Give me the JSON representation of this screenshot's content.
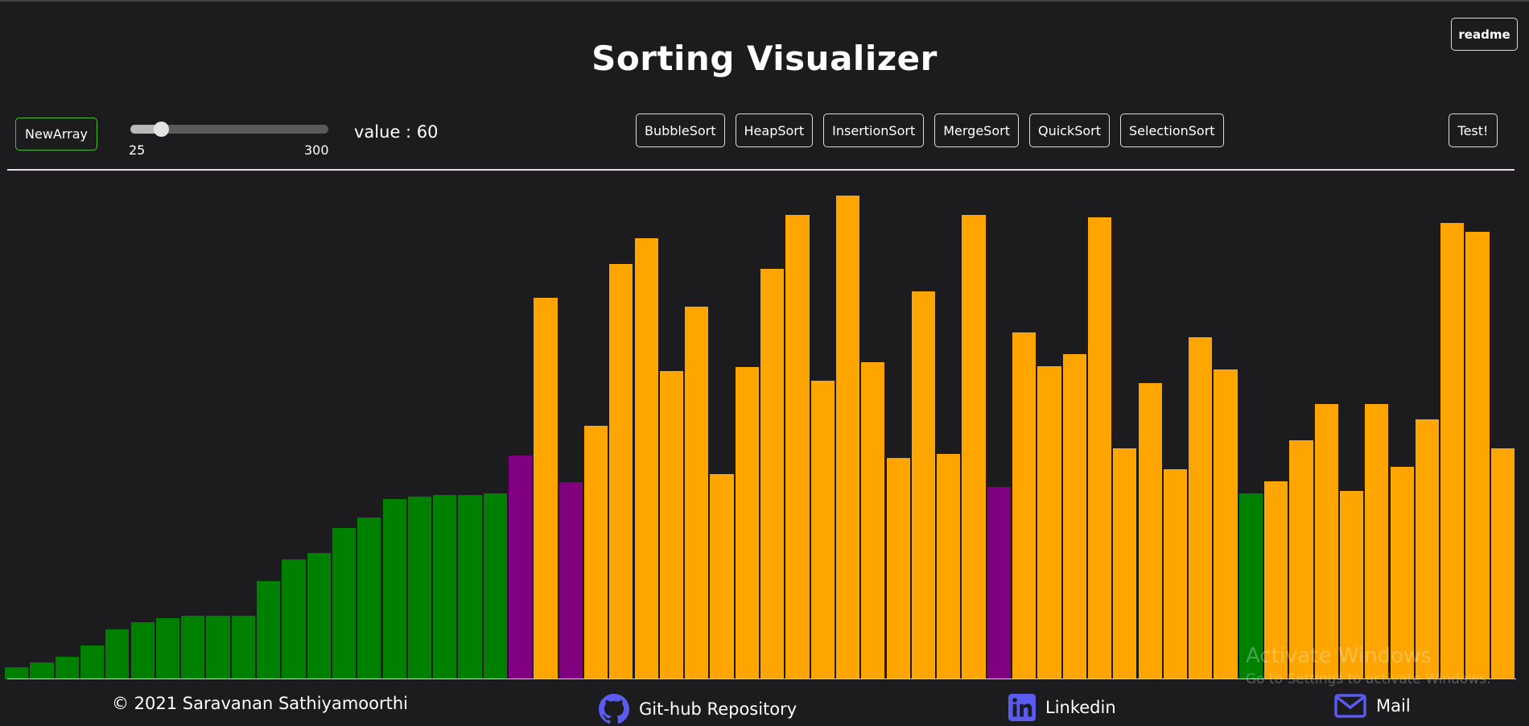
{
  "header": {
    "title": "Sorting Visualizer",
    "readme_label": "readme"
  },
  "controls": {
    "new_array_label": "NewArray",
    "slider": {
      "min_label": "25",
      "max_label": "300",
      "min": 25,
      "max": 300,
      "value": 60
    },
    "value_text": "value : 60",
    "algorithms": [
      "BubbleSort",
      "HeapSort",
      "InsertionSort",
      "MergeSort",
      "QuickSort",
      "SelectionSort"
    ],
    "test_label": "Test!"
  },
  "colors": {
    "sorted": "#008000",
    "active": "#800080",
    "unsorted": "#ffa500",
    "newarray_border": "#4bbf2b"
  },
  "bars": [
    {
      "v": 14,
      "s": "sorted"
    },
    {
      "v": 20,
      "s": "sorted"
    },
    {
      "v": 27,
      "s": "sorted"
    },
    {
      "v": 40,
      "s": "sorted"
    },
    {
      "v": 60,
      "s": "sorted"
    },
    {
      "v": 68,
      "s": "sorted"
    },
    {
      "v": 73,
      "s": "sorted"
    },
    {
      "v": 76,
      "s": "sorted"
    },
    {
      "v": 76,
      "s": "sorted"
    },
    {
      "v": 76,
      "s": "sorted"
    },
    {
      "v": 117,
      "s": "sorted"
    },
    {
      "v": 143,
      "s": "sorted"
    },
    {
      "v": 151,
      "s": "sorted"
    },
    {
      "v": 181,
      "s": "sorted"
    },
    {
      "v": 193,
      "s": "sorted"
    },
    {
      "v": 215,
      "s": "sorted"
    },
    {
      "v": 218,
      "s": "sorted"
    },
    {
      "v": 220,
      "s": "sorted"
    },
    {
      "v": 220,
      "s": "sorted"
    },
    {
      "v": 222,
      "s": "sorted"
    },
    {
      "v": 267,
      "s": "active"
    },
    {
      "v": 456,
      "s": "unsorted"
    },
    {
      "v": 236,
      "s": "active"
    },
    {
      "v": 303,
      "s": "unsorted"
    },
    {
      "v": 496,
      "s": "unsorted"
    },
    {
      "v": 527,
      "s": "unsorted"
    },
    {
      "v": 368,
      "s": "unsorted"
    },
    {
      "v": 445,
      "s": "unsorted"
    },
    {
      "v": 245,
      "s": "unsorted"
    },
    {
      "v": 373,
      "s": "unsorted"
    },
    {
      "v": 490,
      "s": "unsorted"
    },
    {
      "v": 555,
      "s": "unsorted"
    },
    {
      "v": 357,
      "s": "unsorted"
    },
    {
      "v": 578,
      "s": "unsorted"
    },
    {
      "v": 379,
      "s": "unsorted"
    },
    {
      "v": 264,
      "s": "unsorted"
    },
    {
      "v": 463,
      "s": "unsorted"
    },
    {
      "v": 269,
      "s": "unsorted"
    },
    {
      "v": 555,
      "s": "unsorted"
    },
    {
      "v": 230,
      "s": "active"
    },
    {
      "v": 414,
      "s": "unsorted"
    },
    {
      "v": 374,
      "s": "unsorted"
    },
    {
      "v": 388,
      "s": "unsorted"
    },
    {
      "v": 552,
      "s": "unsorted"
    },
    {
      "v": 276,
      "s": "unsorted"
    },
    {
      "v": 354,
      "s": "unsorted"
    },
    {
      "v": 251,
      "s": "unsorted"
    },
    {
      "v": 409,
      "s": "unsorted"
    },
    {
      "v": 370,
      "s": "unsorted"
    },
    {
      "v": 222,
      "s": "sorted"
    },
    {
      "v": 237,
      "s": "unsorted"
    },
    {
      "v": 286,
      "s": "unsorted"
    },
    {
      "v": 329,
      "s": "unsorted"
    },
    {
      "v": 225,
      "s": "unsorted"
    },
    {
      "v": 329,
      "s": "unsorted"
    },
    {
      "v": 254,
      "s": "unsorted"
    },
    {
      "v": 311,
      "s": "unsorted"
    },
    {
      "v": 545,
      "s": "unsorted"
    },
    {
      "v": 535,
      "s": "unsorted"
    },
    {
      "v": 276,
      "s": "unsorted"
    }
  ],
  "watermark": {
    "line1": "Activate Windows",
    "line2": "Go to Settings to activate Windows."
  },
  "footer": {
    "copyright": "© 2021 Saravanan Sathiyamoorthi",
    "github": "Git-hub Repository",
    "linkedin": "Linkedin",
    "mail": "Mail",
    "icon_color": "#5b5bf0"
  }
}
